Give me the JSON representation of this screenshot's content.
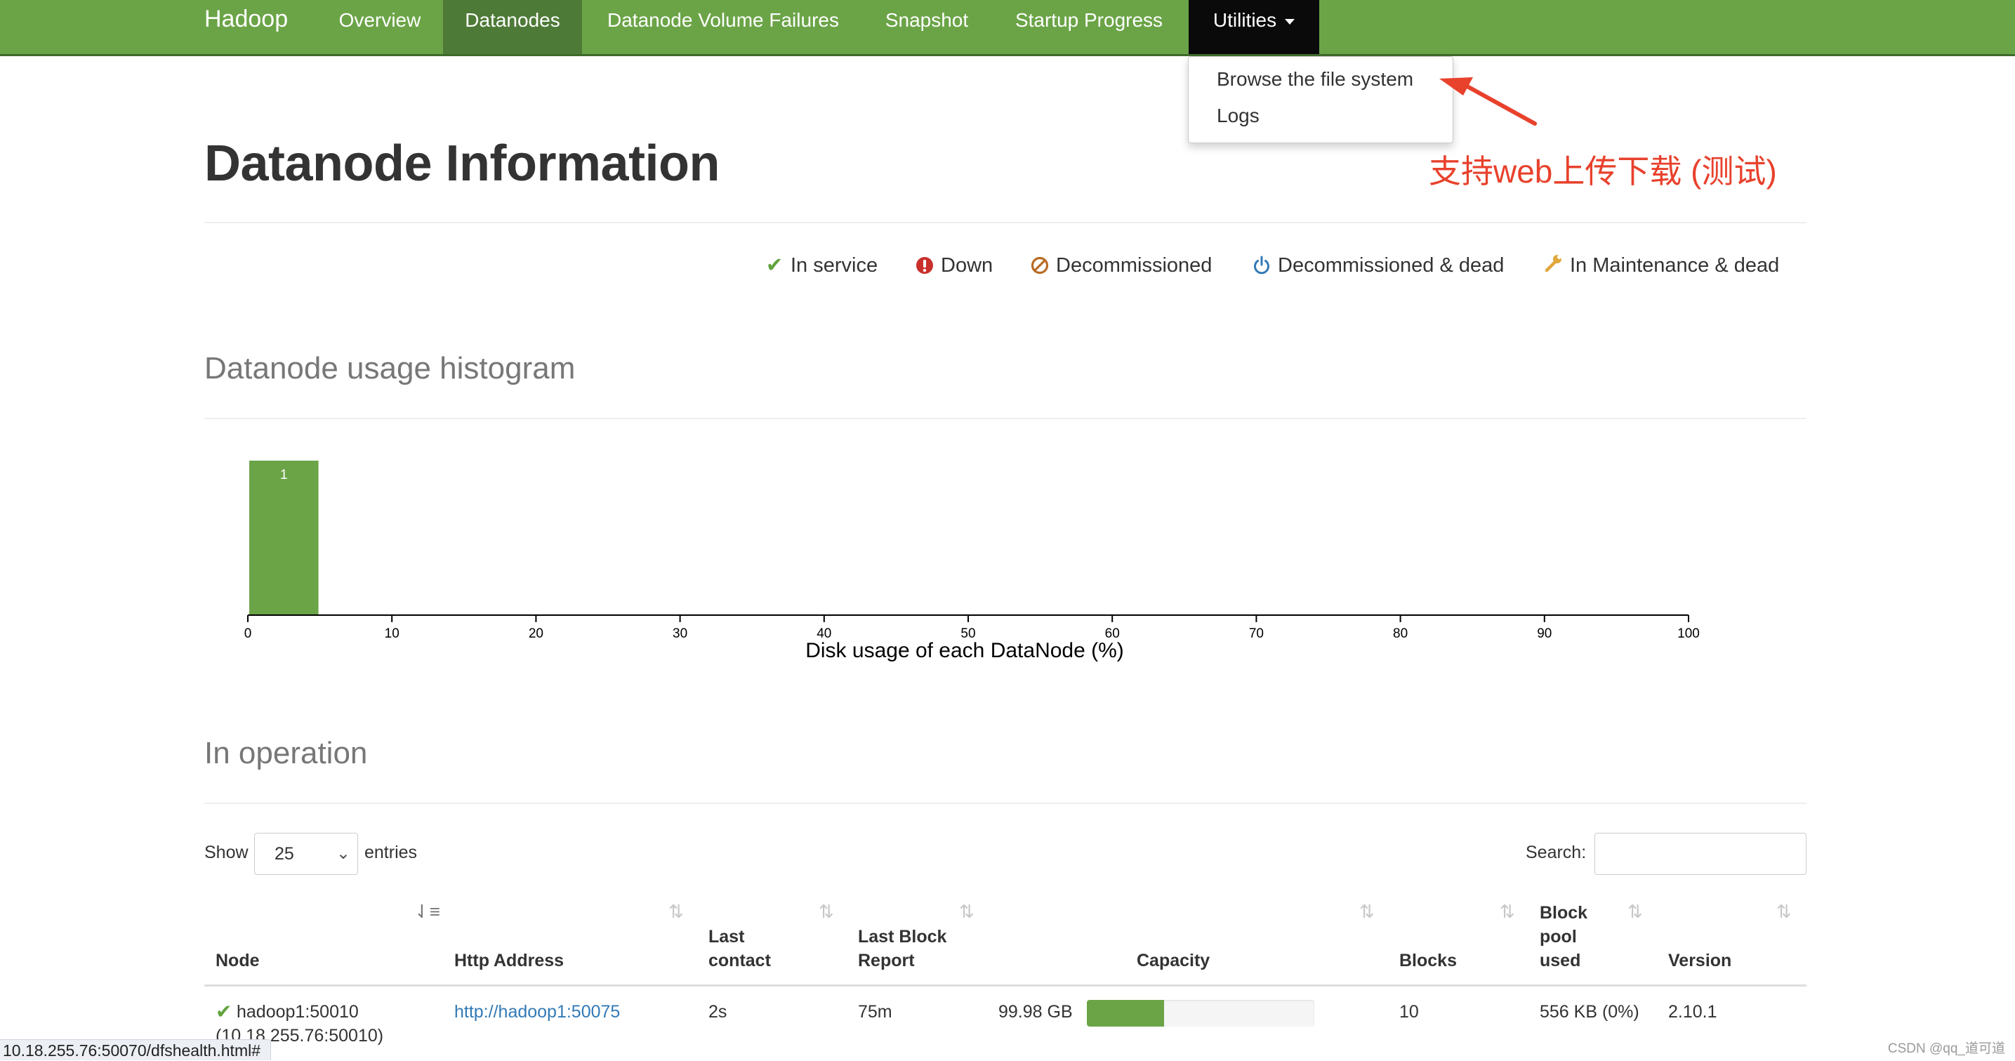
{
  "navbar": {
    "brand": "Hadoop",
    "items": [
      {
        "label": "Overview"
      },
      {
        "label": "Datanodes"
      },
      {
        "label": "Datanode Volume Failures"
      },
      {
        "label": "Snapshot"
      },
      {
        "label": "Startup Progress"
      },
      {
        "label": "Utilities"
      }
    ],
    "active_item": "Datanodes",
    "color": "#6ba447"
  },
  "dropdown": {
    "items": [
      {
        "label": "Browse the file system"
      },
      {
        "label": "Logs"
      }
    ]
  },
  "annotation": {
    "text": "支持web上传下载 (测试)",
    "color": "#e8412c"
  },
  "page": {
    "title": "Datanode Information"
  },
  "legend": [
    {
      "label": "In service",
      "icon": "check-icon",
      "color": "#5fa33c"
    },
    {
      "label": "Down",
      "icon": "exclamation-circle-icon",
      "color": "#c9302c"
    },
    {
      "label": "Decommissioned",
      "icon": "ban-icon",
      "color": "#b86b24"
    },
    {
      "label": "Decommissioned & dead",
      "icon": "power-icon",
      "color": "#337ab7"
    },
    {
      "label": "In Maintenance & dead",
      "icon": "wrench-icon",
      "color": "#e0a73a"
    }
  ],
  "histogram": {
    "section_title": "Datanode usage histogram"
  },
  "chart_data": {
    "type": "bar",
    "title": "",
    "xlabel": "Disk usage of each DataNode (%)",
    "ylabel": "",
    "xlim": [
      0,
      100
    ],
    "x_ticks": [
      0,
      10,
      20,
      30,
      40,
      50,
      60,
      70,
      80,
      90,
      100
    ],
    "bins": [
      {
        "x0": 0,
        "x1": 5,
        "count": 1,
        "label": "1"
      }
    ],
    "bar_color": "#6ba447",
    "grid": false
  },
  "operation": {
    "section_title": "In operation",
    "show_label": "Show",
    "entries_value": "25",
    "entries_label": "entries",
    "search_label": "Search:",
    "search_value": "",
    "columns": [
      "Node",
      "Http Address",
      "Last contact",
      "Last Block Report",
      "Capacity",
      "Blocks",
      "Block pool used",
      "Version"
    ],
    "rows": [
      {
        "node": "hadoop1:50010",
        "node_ip": "(10.18.255.76:50010)",
        "http_address": "http://hadoop1:50075",
        "last_contact": "2s",
        "last_block_report": "75m",
        "capacity": "99.98 GB",
        "capacity_used_fraction": 0.34,
        "blocks": "10",
        "block_pool_used": "556 KB (0%)",
        "version": "2.10.1"
      }
    ]
  },
  "statusbar": {
    "url": "10.18.255.76:50070/dfshealth.html#"
  },
  "watermark": "CSDN @qq_道可道"
}
